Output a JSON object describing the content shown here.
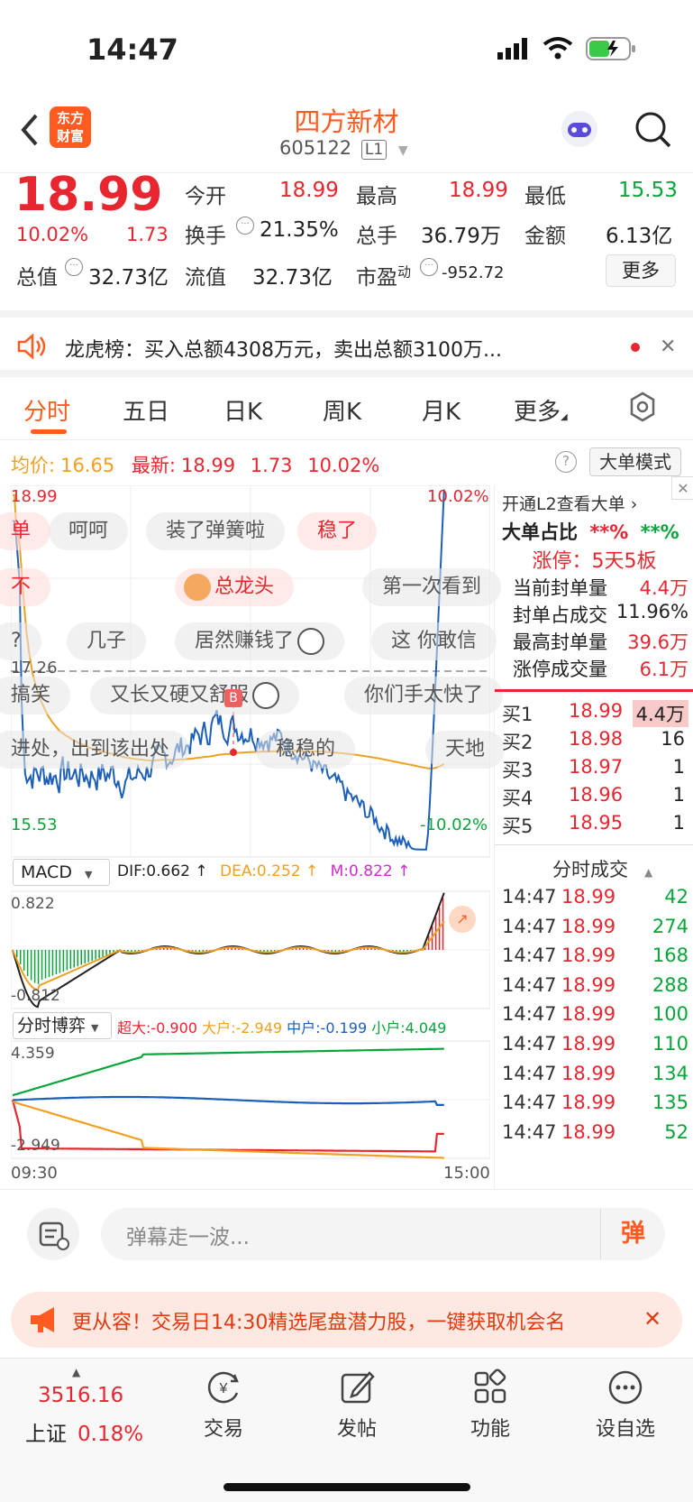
{
  "status": {
    "time": "14:47"
  },
  "header": {
    "logo_line1": "东方",
    "logo_line2": "财富",
    "title": "四方新材",
    "code": "605122",
    "level": "L1"
  },
  "quote": {
    "price": "18.99",
    "pct": "10.02%",
    "chg": "1.73",
    "open_label": "今开",
    "open": "18.99",
    "high_label": "最高",
    "high": "18.99",
    "low_label": "最低",
    "low": "15.53",
    "turnover_label": "换手",
    "turnover": "21.35%",
    "volume_label": "总手",
    "volume": "36.79万",
    "amount_label": "金额",
    "amount": "6.13亿",
    "mktcap_label": "总值",
    "mktcap": "32.73亿",
    "float_label": "流值",
    "float": "32.73亿",
    "pe_label": "市盈",
    "pe_sup": "动",
    "pe": "-952.72",
    "more": "更多"
  },
  "news": {
    "text": "龙虎榜：买入总额4308万元，卖出总额3100万..."
  },
  "tabs": [
    "分时",
    "五日",
    "日K",
    "周K",
    "月K",
    "更多"
  ],
  "chart": {
    "avg_label": "均价:",
    "avg": "16.65",
    "latest_label": "最新:",
    "latest": "18.99",
    "chg": "1.73",
    "pct": "10.02%",
    "mode": "大单模式",
    "top_left": "18.99",
    "top_right": "10.02%",
    "bottom_left": "15.53",
    "bottom_right": "-10.02%",
    "mid": "17.26",
    "macd_label": "MACD",
    "dif": "DIF:0.662 ↑",
    "dea": "DEA:0.252 ↑",
    "m": "M:0.822 ↑",
    "macd_top": "0.822",
    "macd_bot": "-0.812",
    "game_label": "分时博弈",
    "super": "超大:-0.900",
    "big": "大户:-2.949",
    "mid_h": "中户:-0.199",
    "small": "小户:4.049",
    "game_top": "4.359",
    "game_bot": "-2.949",
    "t_start": "09:30",
    "t_end": "15:00",
    "marker": "B"
  },
  "danmu": [
    "单",
    "呵呵",
    "装了弹簧啦",
    "稳了",
    "不",
    "总龙头",
    "第一次看到",
    "?",
    "几子",
    "居然赚钱了",
    "这 你敢信",
    "搞笑",
    "又长又硬又舒服",
    "你们手太快了",
    "进处，出到该出处",
    "稳稳的",
    "天地"
  ],
  "right": {
    "l2": "开通L2查看大单 ›",
    "big_ratio": "大单占比",
    "bs1": "**%",
    "bs2": "**%",
    "limit": "涨停：5天5板",
    "seal_label": "当前封单量",
    "seal": "4.4万",
    "ratio_label": "封单占成交",
    "ratio": "11.96%",
    "maxseal_label": "最高封单量",
    "maxseal": "39.6万",
    "limvol_label": "涨停成交量",
    "limvol": "6.1万",
    "book": [
      {
        "l": "买1",
        "p": "18.99",
        "v": "4.4万"
      },
      {
        "l": "买2",
        "p": "18.98",
        "v": "16"
      },
      {
        "l": "买3",
        "p": "18.97",
        "v": "1"
      },
      {
        "l": "买4",
        "p": "18.96",
        "v": "1"
      },
      {
        "l": "买5",
        "p": "18.95",
        "v": "1"
      }
    ],
    "ticks_title": "分时成交",
    "ticks": [
      {
        "t": "14:47",
        "p": "18.99",
        "v": "42"
      },
      {
        "t": "14:47",
        "p": "18.99",
        "v": "274"
      },
      {
        "t": "14:47",
        "p": "18.99",
        "v": "168"
      },
      {
        "t": "14:47",
        "p": "18.99",
        "v": "288"
      },
      {
        "t": "14:47",
        "p": "18.99",
        "v": "100"
      },
      {
        "t": "14:47",
        "p": "18.99",
        "v": "110"
      },
      {
        "t": "14:47",
        "p": "18.99",
        "v": "134"
      },
      {
        "t": "14:47",
        "p": "18.99",
        "v": "135"
      },
      {
        "t": "14:47",
        "p": "18.99",
        "v": "52"
      }
    ]
  },
  "input": {
    "placeholder": "弹幕走一波...",
    "send": "弹"
  },
  "banner": {
    "text": "更从容！交易日14:30精选尾盘潜力股，一键获取机会名"
  },
  "bottom": {
    "index_value": "3516.16",
    "index_name": "上证",
    "index_pct": "0.18%",
    "nav": [
      "交易",
      "发帖",
      "功能",
      "设自选"
    ]
  },
  "colors": {
    "up": "#e8262f",
    "down": "#0aa53a",
    "price_line": "#1c5fb8",
    "avg_line": "#f0a020",
    "accent": "#ff6a00"
  }
}
